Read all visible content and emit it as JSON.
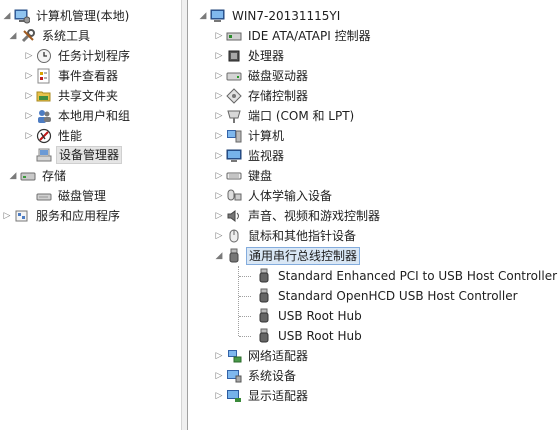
{
  "left_tree": {
    "root": "计算机管理(本地)",
    "system_tools": "系统工具",
    "items": [
      "任务计划程序",
      "事件查看器",
      "共享文件夹",
      "本地用户和组",
      "性能",
      "设备管理器"
    ],
    "storage": "存储",
    "disk_mgmt": "磁盘管理",
    "services": "服务和应用程序"
  },
  "device_tree": {
    "computer": "WIN7-20131115YI",
    "categories": [
      {
        "label": "IDE ATA/ATAPI 控制器",
        "icon": "ide-controller-icon"
      },
      {
        "label": "处理器",
        "icon": "processor-icon"
      },
      {
        "label": "磁盘驱动器",
        "icon": "disk-drive-icon"
      },
      {
        "label": "存储控制器",
        "icon": "storage-controller-icon"
      },
      {
        "label": "端口 (COM 和 LPT)",
        "icon": "port-icon"
      },
      {
        "label": "计算机",
        "icon": "computer-icon"
      },
      {
        "label": "监视器",
        "icon": "monitor-icon"
      },
      {
        "label": "键盘",
        "icon": "keyboard-icon"
      },
      {
        "label": "人体学输入设备",
        "icon": "hid-icon"
      },
      {
        "label": "声音、视频和游戏控制器",
        "icon": "sound-icon"
      },
      {
        "label": "鼠标和其他指针设备",
        "icon": "mouse-icon"
      }
    ],
    "usb": {
      "label": "通用串行总线控制器",
      "children": [
        "Standard Enhanced PCI to USB Host Controller",
        "Standard OpenHCD USB Host Controller",
        "USB Root Hub",
        "USB Root Hub"
      ]
    },
    "tail": [
      {
        "label": "网络适配器",
        "icon": "network-adapter-icon"
      },
      {
        "label": "系统设备",
        "icon": "system-device-icon"
      },
      {
        "label": "显示适配器",
        "icon": "display-adapter-icon"
      }
    ]
  }
}
